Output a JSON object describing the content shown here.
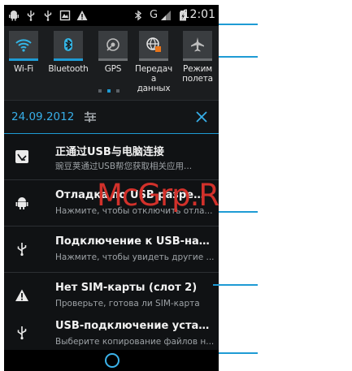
{
  "status_bar": {
    "left_icons": [
      "android-debug-icon",
      "usb-icon",
      "usb-icon",
      "image-icon",
      "warning-icon"
    ],
    "right_icons": [
      "bluetooth-icon",
      "g-network-icon",
      "signal-icon",
      "battery-icon"
    ],
    "network_type": "G",
    "time": "12:01"
  },
  "quick_settings": {
    "tiles": [
      {
        "label": "Wi-Fi",
        "icon": "wifi-icon",
        "active": true
      },
      {
        "label": "Bluetooth",
        "icon": "bluetooth-icon",
        "active": true
      },
      {
        "label": "GPS",
        "icon": "gps-icon",
        "active": false
      },
      {
        "label": "Передач\nа данных",
        "icon": "data-transfer-icon",
        "active": false
      },
      {
        "label": "Режим\nполета",
        "icon": "airplane-icon",
        "active": false
      }
    ],
    "page_count": 3,
    "active_page": 1
  },
  "date_bar": {
    "date": "24.09.2012"
  },
  "notifications": [
    {
      "icon": "usb-pc-icon",
      "title": "正通过USB与电脑连接",
      "subtitle": "豌豆荚通过USB帮您获取相关应用..."
    },
    {
      "icon": "android-debug-icon",
      "title": "Отладка по USB разрешена",
      "subtitle": "Нажмите, чтобы отключить отла..."
    },
    {
      "icon": "usb-icon",
      "title": "Подключение к USB-нако...",
      "subtitle": "Нажмите, чтобы увидеть другие ..."
    },
    {
      "icon": "warning-icon",
      "title": "Нет SIM-карты (слот 2)",
      "subtitle": "Проверьте, готова ли SIM-карта"
    },
    {
      "icon": "usb-icon",
      "title": "USB-подключение устано...",
      "subtitle": "Выберите копирование файлов н..."
    }
  ],
  "watermark": "McGrp.Ru",
  "colors": {
    "accent": "#1e9bd4",
    "date_text": "#37aee8",
    "watermark": "#d2312b",
    "background": "#101010"
  }
}
